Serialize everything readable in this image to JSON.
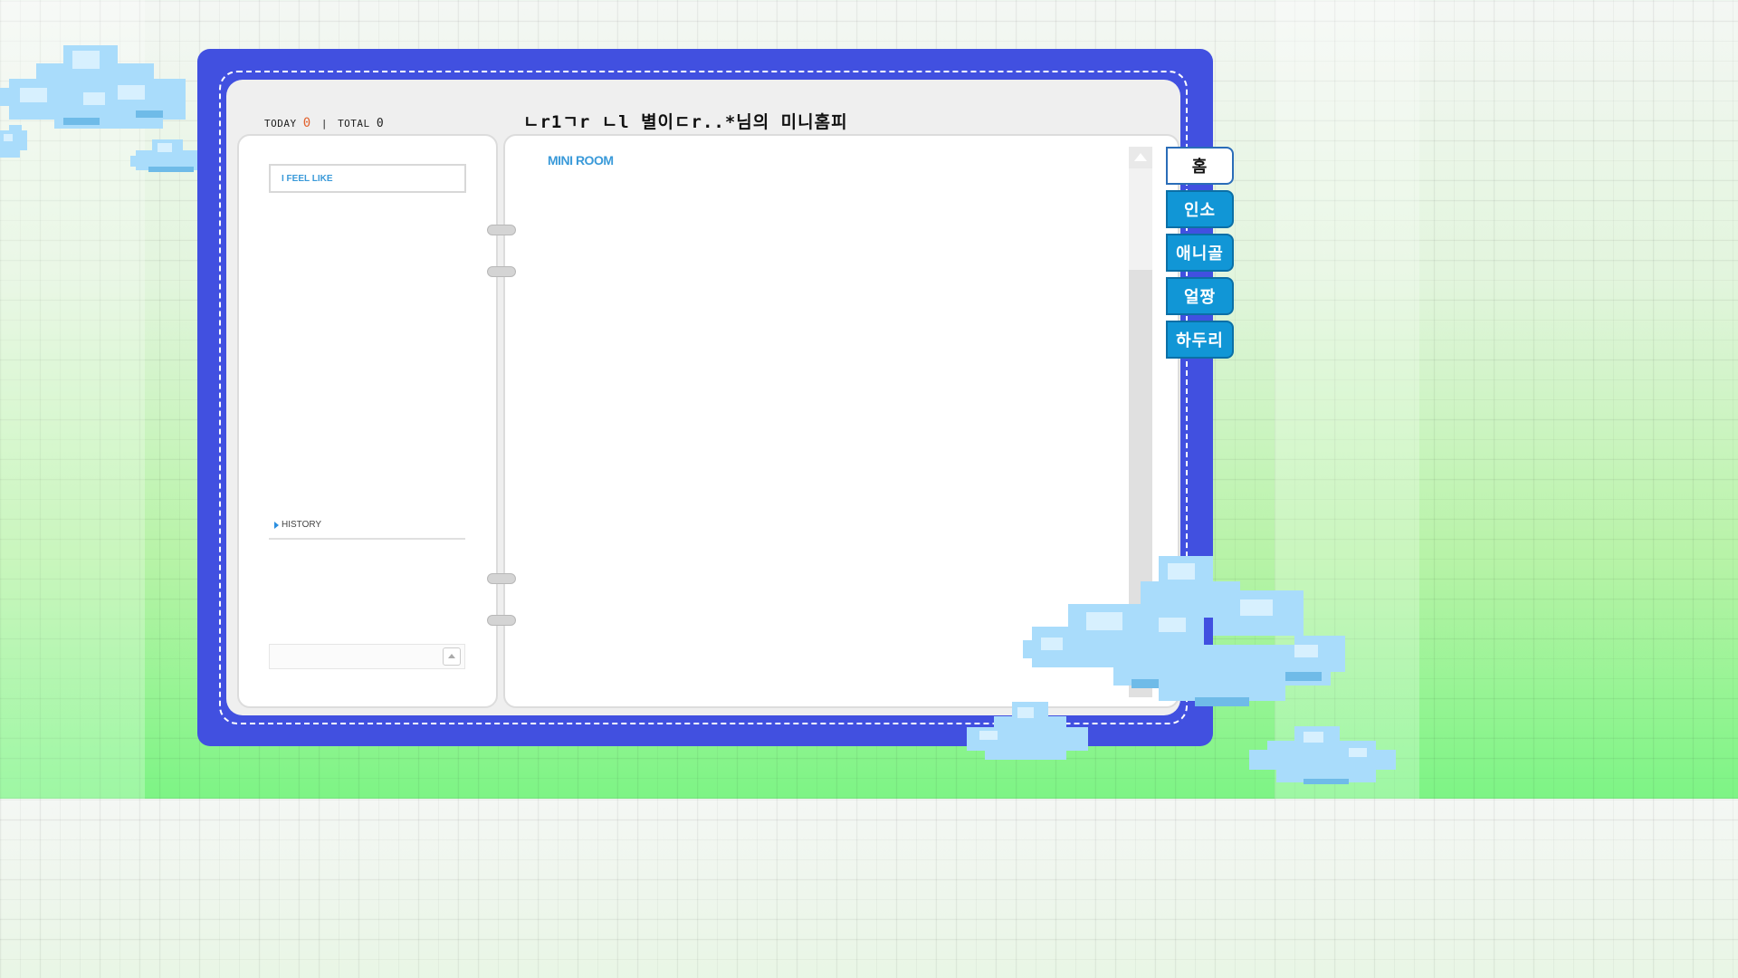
{
  "counter": {
    "today_label": "TODAY",
    "today_value": "0",
    "separator": "|",
    "total_label": "TOTAL",
    "total_value": "0"
  },
  "title": "ㄴr1ㄱr ㄴl 별이ㄷr..*님의 미니홈피",
  "left_page": {
    "feel_label": "I FEEL LIKE",
    "history_label": "HISTORY"
  },
  "right_page": {
    "section_title": "MINI ROOM"
  },
  "tabs": [
    {
      "label": "홈",
      "active": true
    },
    {
      "label": "인소",
      "active": false
    },
    {
      "label": "애니골",
      "active": false
    },
    {
      "label": "얼짱",
      "active": false
    },
    {
      "label": "하두리",
      "active": false
    }
  ],
  "colors": {
    "binder": "#4150e0",
    "tab": "#1196d6",
    "accent_text": "#3a9ad9",
    "today_count": "#e2612d"
  }
}
